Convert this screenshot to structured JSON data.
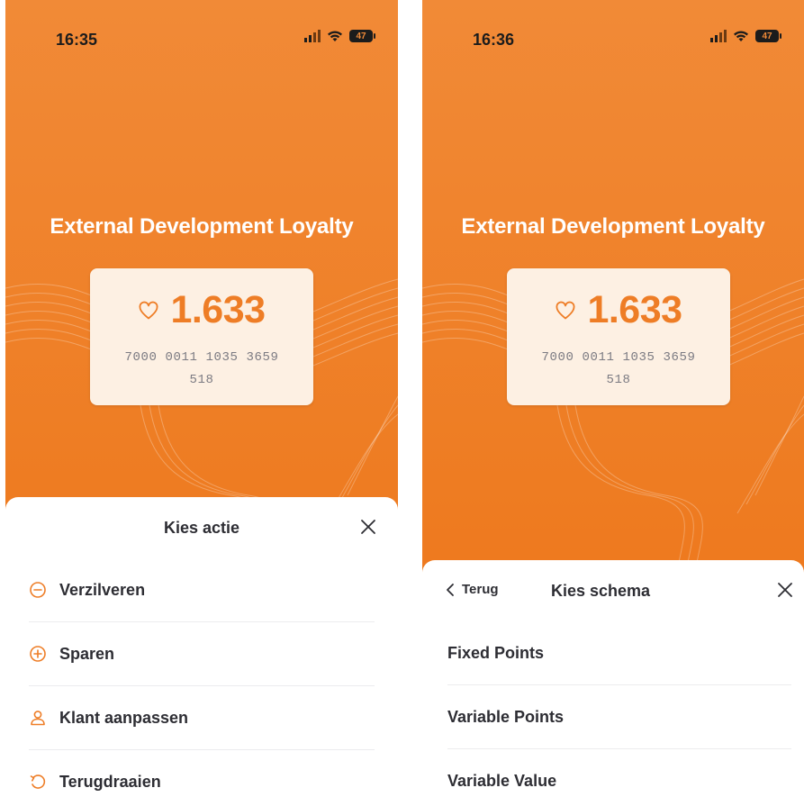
{
  "colors": {
    "accent": "#ee7d26",
    "card_bg": "#fdf0e3",
    "text_dark": "#2d2d33",
    "muted": "#7b7a82"
  },
  "left_screen": {
    "status_bar": {
      "time": "16:35",
      "battery": "47"
    },
    "program_title": "External Development Loyalty",
    "card": {
      "points": "1.633",
      "card_number": "7000 0011 1035 3659 518"
    },
    "sheet": {
      "title": "Kies actie",
      "close_icon": "close-icon",
      "items": [
        {
          "label": "Verzilveren",
          "icon": "minus-circle-icon"
        },
        {
          "label": "Sparen",
          "icon": "plus-circle-icon"
        },
        {
          "label": "Klant aanpassen",
          "icon": "user-icon"
        },
        {
          "label": "Terugdraaien",
          "icon": "undo-icon"
        }
      ]
    }
  },
  "right_screen": {
    "status_bar": {
      "time": "16:36",
      "battery": "47"
    },
    "program_title": "External Development Loyalty",
    "card": {
      "points": "1.633",
      "card_number": "7000 0011 1035 3659 518"
    },
    "sheet": {
      "back_label": "Terug",
      "title": "Kies schema",
      "close_icon": "close-icon",
      "items": [
        {
          "label": "Fixed Points"
        },
        {
          "label": "Variable Points"
        },
        {
          "label": "Variable Value"
        }
      ]
    }
  }
}
